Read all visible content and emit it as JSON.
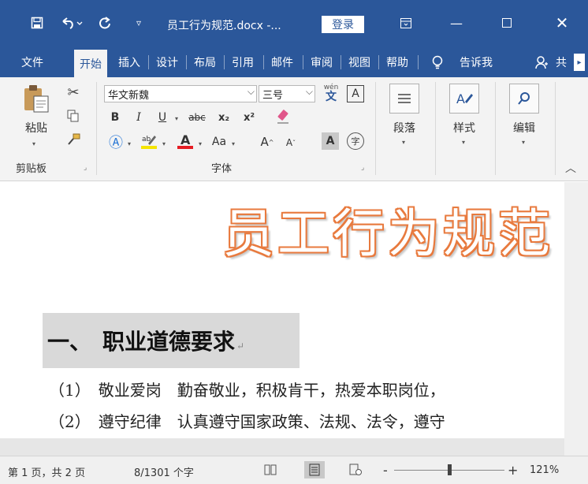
{
  "titlebar": {
    "doc_title": "员工行为规范.docx -...",
    "login_label": "登录",
    "color": "#2b579a",
    "icons": [
      "save-icon",
      "undo-icon",
      "redo-icon",
      "customize-qat-icon",
      "ribbon-display-icon",
      "minimize-icon",
      "maximize-icon",
      "close-icon"
    ]
  },
  "tabs": [
    {
      "label": "文件"
    },
    {
      "label": "开始"
    },
    {
      "label": "插入"
    },
    {
      "label": "设计"
    },
    {
      "label": "布局"
    },
    {
      "label": "引用"
    },
    {
      "label": "邮件"
    },
    {
      "label": "审阅"
    },
    {
      "label": "视图"
    },
    {
      "label": "帮助"
    },
    {
      "label": "告诉我"
    },
    {
      "label": "共"
    }
  ],
  "ribbon": {
    "clipboard": {
      "paste_label": "粘贴",
      "group_label": "剪贴板"
    },
    "font": {
      "font_name": "华文新魏",
      "font_size": "三号",
      "phonetic_label": "wén",
      "group_label": "字体",
      "bold": "B",
      "italic": "I",
      "underline": "U",
      "strike": "abc",
      "subscript": "x₂",
      "superscript": "x²",
      "change_case": "Aa",
      "grow": "A",
      "shrink": "A",
      "char_shading": "A",
      "enclose": "字",
      "border_char": "A"
    },
    "paragraph": {
      "label": "段落"
    },
    "styles": {
      "label": "样式"
    },
    "editing": {
      "label": "编辑"
    }
  },
  "document": {
    "title": "员工行为规范",
    "heading": "一、　职业道德要求",
    "lines": [
      "（1）　敬业爱岗　勤奋敬业，积极肯干，热爱本职岗位，",
      "（2）　遵守纪律　认真遵守国家政策、法规、法令，遵守"
    ]
  },
  "statusbar": {
    "page_info": "第 1 页，共 2 页",
    "word_count": "8/1301 个字",
    "zoom_minus": "-",
    "zoom_plus": "+",
    "zoom_level": "121%"
  }
}
